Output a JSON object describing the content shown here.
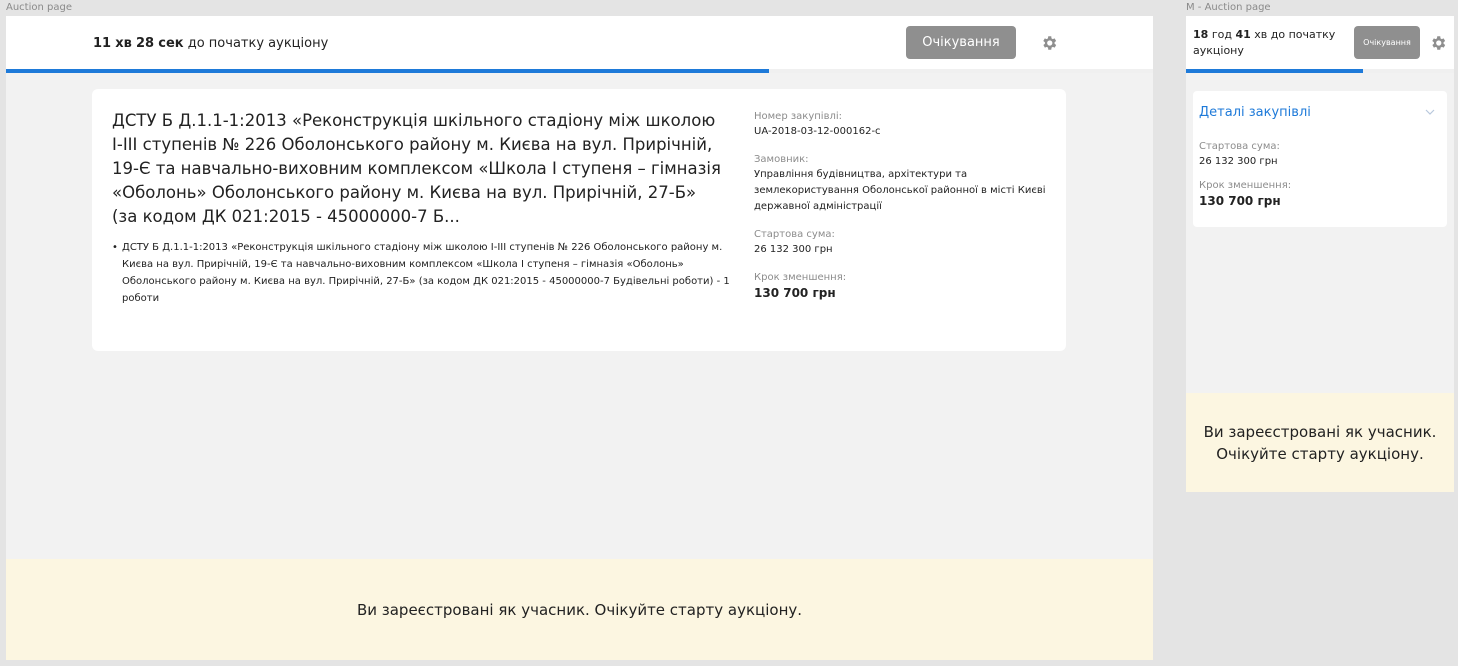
{
  "frames": {
    "desktop_label": "Auction page",
    "mobile_label": "M - Auction page"
  },
  "desktop": {
    "countdown": {
      "minutes": "11",
      "minutes_unit": "хв",
      "seconds": "28",
      "seconds_unit": "сек",
      "suffix": "до початку аукціону"
    },
    "status_button": "Очікування",
    "progress": 0.665,
    "title": "ДСТУ Б Д.1.1-1:2013 «Реконструкція шкільного стадіону між школою I-III ступенів № 226 Оболонського району м. Києва на вул. Прирічній, 19-Є та навчально-виховним комплексом «Школа I ступеня – гімназія «Оболонь» Оболонського району м. Києва на вул. Прирічній, 27-Б» (за кодом ДК 021:2015 - 45000000-7 Б...",
    "items": [
      "ДСТУ Б Д.1.1-1:2013 «Реконструкція шкільного стадіону між школою I-III ступенів № 226 Оболонського району м. Києва на вул. Прирічній, 19-Є та навчально-виховним комплексом «Школа I ступеня – гімназія «Оболонь» Оболонського району м. Києва на вул. Прирічній, 27-Б» (за кодом ДК 021:2015 - 45000000-7 Будівельні роботи) - 1 роботи"
    ],
    "meta": {
      "procurement_number_label": "Номер закупівлі:",
      "procurement_number": "UA-2018-03-12-000162-c",
      "customer_label": "Замовник:",
      "customer": "Управління будівництва, архітектури та землекористування Оболонської районної в місті Києві державної адміністрації",
      "start_sum_label": "Стартова сума:",
      "start_sum": "26 132 300 грн",
      "step_label": "Крок зменшення:",
      "step": "130 700 грн"
    },
    "banner": "Ви зареєстровані як учасник. Очікуйте старту аукціону."
  },
  "mobile": {
    "countdown": {
      "hours": "18",
      "hours_unit": "год",
      "minutes": "41",
      "minutes_unit": "хв",
      "suffix": "до початку аукціону"
    },
    "status_button": "Очікування",
    "progress": 0.66,
    "details_title": "Деталі закупівлі",
    "meta": {
      "start_sum_label": "Стартова сума:",
      "start_sum": "26 132 300 грн",
      "step_label": "Крок зменшення:",
      "step": "130 700 грн"
    },
    "banner": "Ви зареєстровані як учасник. Очікуйте старту аукціону."
  },
  "colors": {
    "accent": "#1e7ad9",
    "button_gray": "#8f8f8f",
    "banner_bg": "#fcf6e1"
  },
  "icons": [
    "gear-icon",
    "chevron-down-icon"
  ]
}
